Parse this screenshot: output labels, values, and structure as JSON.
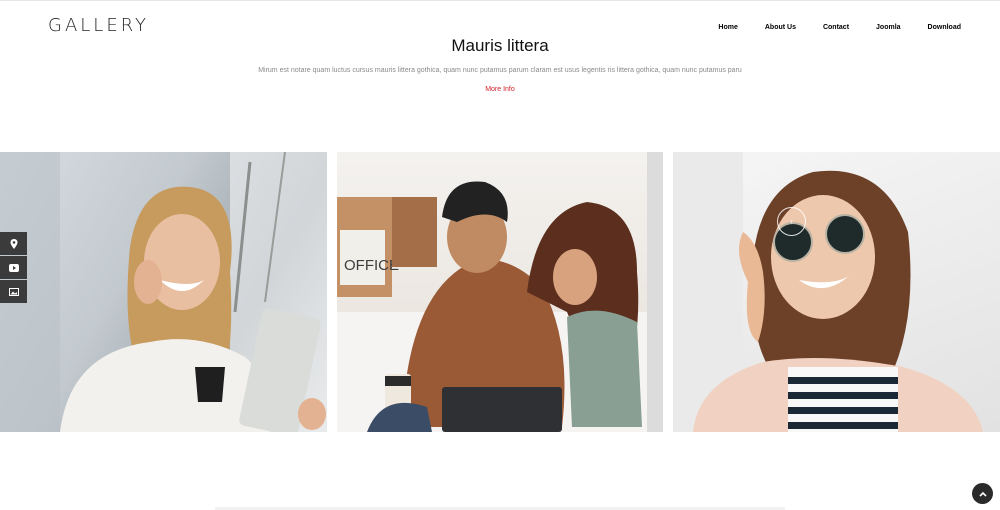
{
  "header": {
    "logo": "GALLERY",
    "nav": [
      "Home",
      "About Us",
      "Contact",
      "Joomla",
      "Download"
    ]
  },
  "hero": {
    "title": "Mauris littera",
    "subtitle": "Mirum est notare quam luctus cursus mauris littera gothica, quam nunc putamus parum claram est usus legentis ris littera gothica, quam nunc putamus paru",
    "more_label": "More Info",
    "accent": "#d3212a"
  },
  "gallery": {
    "photos": [
      {
        "alt": "woman-with-tablet-photo"
      },
      {
        "alt": "couple-with-laptop-photo"
      },
      {
        "alt": "woman-with-sunglasses-photo"
      }
    ],
    "lens_glyph": "›"
  },
  "sidebar": {
    "icons": [
      "map-pin-icon",
      "youtube-icon",
      "image-icon"
    ]
  },
  "scroll_top": {
    "icon": "chevron-up-icon"
  }
}
